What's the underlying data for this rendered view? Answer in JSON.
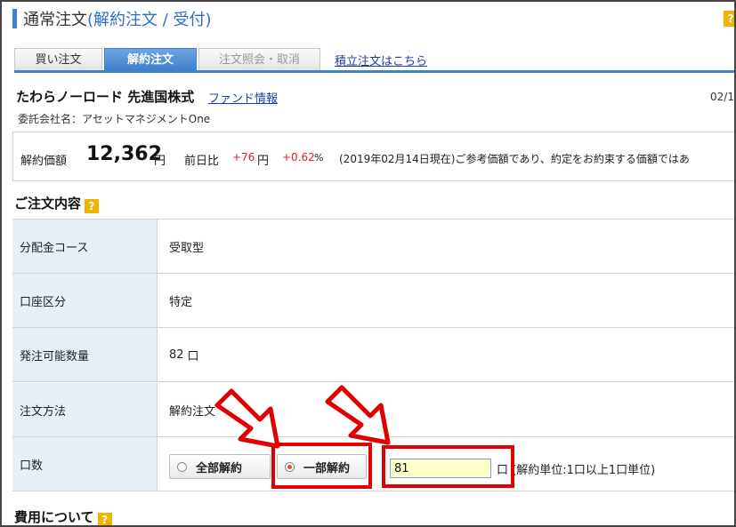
{
  "header": {
    "title_main": "通常注文",
    "title_paren": "(解約注文 / 受付)",
    "help_label": "?"
  },
  "tabs": [
    {
      "label": "買い注文",
      "state": "normal"
    },
    {
      "label": "解約注文",
      "state": "active"
    },
    {
      "label": "注文照会・取消",
      "state": "disabled"
    }
  ],
  "tab_link": "積立注文はこちら",
  "fund": {
    "name": "たわらノーロード 先進国株式",
    "info_link": "ファンド情報",
    "date": "02/1",
    "company": "委託会社名：アセットマネジメントOne"
  },
  "price": {
    "label": "解約価額",
    "value": "12,362",
    "unit": "円",
    "change_label": "前日比",
    "change": "+76",
    "change_unit": "円",
    "change_pct": "+0.62",
    "pct_symbol": "%",
    "note": "(2019年02月14日現在)ご参考価額であり、約定をお約束する価額ではあ"
  },
  "order_section": {
    "title": "ご注文内容",
    "help": "?",
    "rows": [
      {
        "label": "分配金コース",
        "value": "受取型"
      },
      {
        "label": "口座区分",
        "value": "特定"
      },
      {
        "label": "発注可能数量",
        "value": "82",
        "unit": "口"
      },
      {
        "label": "注文方法",
        "value": "解約注文"
      },
      {
        "label": "口数"
      }
    ],
    "radio_all": "全部解約",
    "radio_partial": "一部解約",
    "quantity_value": "81",
    "quantity_unit": "口",
    "quantity_note": "(解約単位:1口以上1口単位)"
  },
  "fee_section": {
    "title": "費用について",
    "help": "?"
  },
  "colors": {
    "accent": "#3f7fcc",
    "highlight": "#e00000",
    "positive": "#e0202f",
    "input_bg": "#ffffc8"
  }
}
